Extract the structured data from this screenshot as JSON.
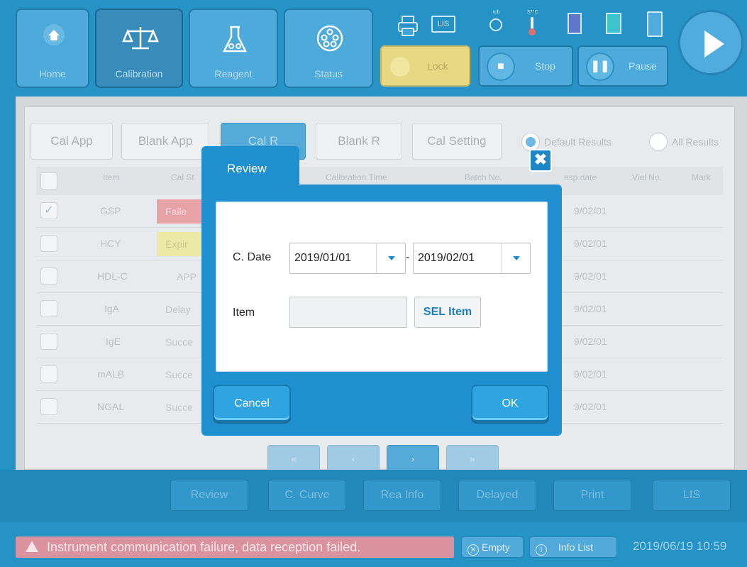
{
  "nav": {
    "home_label": "Home",
    "calibration_label": "Calibration",
    "reagent_label": "Reagent",
    "status_label": "Status",
    "lock_label": "Lock",
    "stop_label": "Stop",
    "pause_label": "Pause"
  },
  "system_icons": {
    "lis_label": "LIS",
    "sensor_a_caption": "tcb",
    "temperature_caption": "37°C"
  },
  "tabs": [
    "Cal App",
    "Blank App",
    "Cal R",
    "Blank R",
    "Cal Setting"
  ],
  "active_tab": "Cal R",
  "result_filter": {
    "default_label": "Default Results",
    "all_label": "All Results",
    "selected": "Default Results"
  },
  "table": {
    "headers": [
      "Item",
      "Cal St",
      "Calibration Time",
      "Batch No.",
      "esp.date",
      "Vial No.",
      "Mark"
    ],
    "rows": [
      {
        "checked": true,
        "item": "GSP",
        "status": "Faile",
        "status_color": "#e79fa5",
        "exp": "9/02/01"
      },
      {
        "checked": false,
        "item": "HCY",
        "status": "Expir",
        "status_color": "#ece9a3",
        "exp": "9/02/01"
      },
      {
        "checked": false,
        "item": "HDL-C",
        "status": "APP",
        "status_color": "",
        "exp": "9/02/01"
      },
      {
        "checked": false,
        "item": "IgA",
        "status": "Delay",
        "status_color": "",
        "exp": "9/02/01"
      },
      {
        "checked": false,
        "item": "IgE",
        "status": "Succe",
        "status_color": "",
        "exp": "9/02/01"
      },
      {
        "checked": false,
        "item": "mALB",
        "status": "Succe",
        "status_color": "",
        "exp": "9/02/01"
      },
      {
        "checked": false,
        "item": "NGAL",
        "status": "Succe",
        "status_color": "",
        "exp": "9/02/01"
      }
    ]
  },
  "pager": [
    "«",
    "‹",
    "›",
    "»"
  ],
  "bottom_buttons": [
    "Review",
    "C. Curve",
    "Rea Info",
    "Delayed",
    "Print",
    "LIS"
  ],
  "statusbar": {
    "alarm_text": "Instrument communication failure, data reception failed.",
    "empty_label": "Empty",
    "info_list_label": "Info List",
    "clock": "2019/06/19 10:59"
  },
  "modal": {
    "title": "Review",
    "close_glyph": "✖",
    "date_label": "C. Date",
    "date_from": "2019/01/01",
    "date_separator": "-",
    "date_to": "2019/02/01",
    "item_label": "Item",
    "item_value": "",
    "sel_item_label": "SEL Item",
    "cancel_label": "Cancel",
    "ok_label": "OK"
  },
  "colors": {
    "brand_blue": "#1f8fcf",
    "failed": "#e79fa5",
    "expired": "#ece9a3",
    "alarm": "#d98e9b",
    "lock": "#e6d77e"
  }
}
